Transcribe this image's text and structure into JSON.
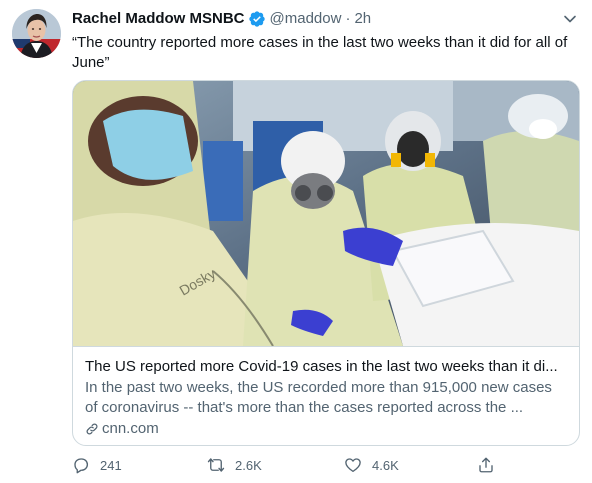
{
  "author": {
    "name": "Rachel Maddow MSNBC",
    "handle": "@maddow",
    "separator": "·",
    "time": "2h",
    "verified": true
  },
  "tweet": {
    "text": "“The country reported more cases in the last two weeks than it did for all of June”"
  },
  "card": {
    "title": "The US reported more Covid-19 cases in the last two weeks than it di...",
    "description": "In the past two weeks, the US recorded more than 915,000 new cases of coronavirus -- that's more than the cases reported across the ...",
    "domain": "cnn.com"
  },
  "actions": {
    "reply_count": "241",
    "retweet_count": "2.6K",
    "like_count": "4.6K"
  },
  "colors": {
    "text_primary": "#0f1419",
    "text_secondary": "#536471",
    "border": "#cfd9de",
    "verified_blue": "#1d9bf0"
  },
  "icons": [
    "verified-badge-icon",
    "chevron-down-icon",
    "link-icon",
    "reply-icon",
    "retweet-icon",
    "like-icon",
    "share-icon"
  ]
}
